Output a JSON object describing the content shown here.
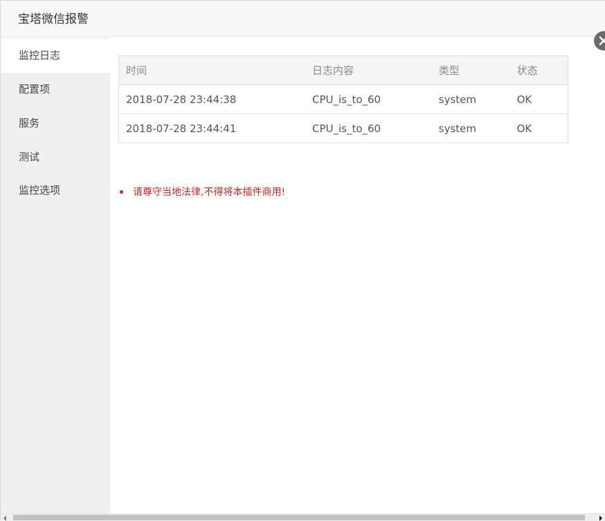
{
  "dialog": {
    "title": "宝塔微信报警"
  },
  "sidebar": {
    "items": [
      {
        "label": "监控日志",
        "active": true
      },
      {
        "label": "配置项",
        "active": false
      },
      {
        "label": "服务",
        "active": false
      },
      {
        "label": "测试",
        "active": false
      },
      {
        "label": "监控选项",
        "active": false
      }
    ]
  },
  "log_table": {
    "headers": [
      "时间",
      "日志内容",
      "类型",
      "状态"
    ],
    "rows": [
      [
        "2018-07-28 23:44:38",
        "CPU_is_to_60",
        "system",
        "OK"
      ],
      [
        "2018-07-28 23:44:41",
        "CPU_is_to_60",
        "system",
        "OK"
      ]
    ]
  },
  "notice": {
    "text": "请尊守当地法律,不得将本插件商用!",
    "color": "#e02020"
  },
  "icons": {
    "close": "close-icon"
  }
}
